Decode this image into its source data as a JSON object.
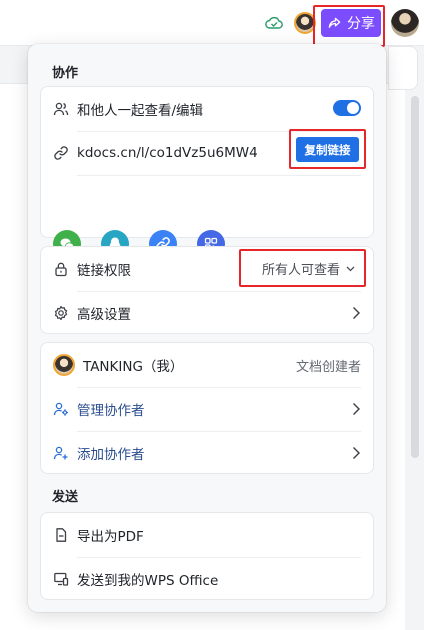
{
  "toolbar": {
    "share_label": "分享",
    "accent": "#7c4dff"
  },
  "panel": {
    "collab": {
      "title": "协作",
      "coedit_label": "和他人一起查看/编辑",
      "coedit_enabled": true,
      "link_text": "kdocs.cn/l/co1dVz5u6MW4",
      "copy_label": "复制链接",
      "share_channels": [
        "wechat-icon",
        "qq-icon",
        "link-icon",
        "qrcode-icon"
      ]
    },
    "permission": {
      "label": "链接权限",
      "value": "所有人可查看",
      "advanced_label": "高级设置"
    },
    "members": {
      "owner_name": "TANKING（我）",
      "owner_role": "文档创建者",
      "manage_label": "管理协作者",
      "add_label": "添加协作者"
    },
    "send": {
      "title": "发送",
      "export_pdf_label": "导出为PDF",
      "send_wps_label": "发送到我的WPS Office"
    }
  },
  "colors": {
    "primary": "#1f6fe5",
    "highlight": "#e5262b",
    "wechat": "#3fb04a",
    "qq": "#26a6c2",
    "link": "#3b82f6",
    "qrcode": "#4468e6"
  }
}
